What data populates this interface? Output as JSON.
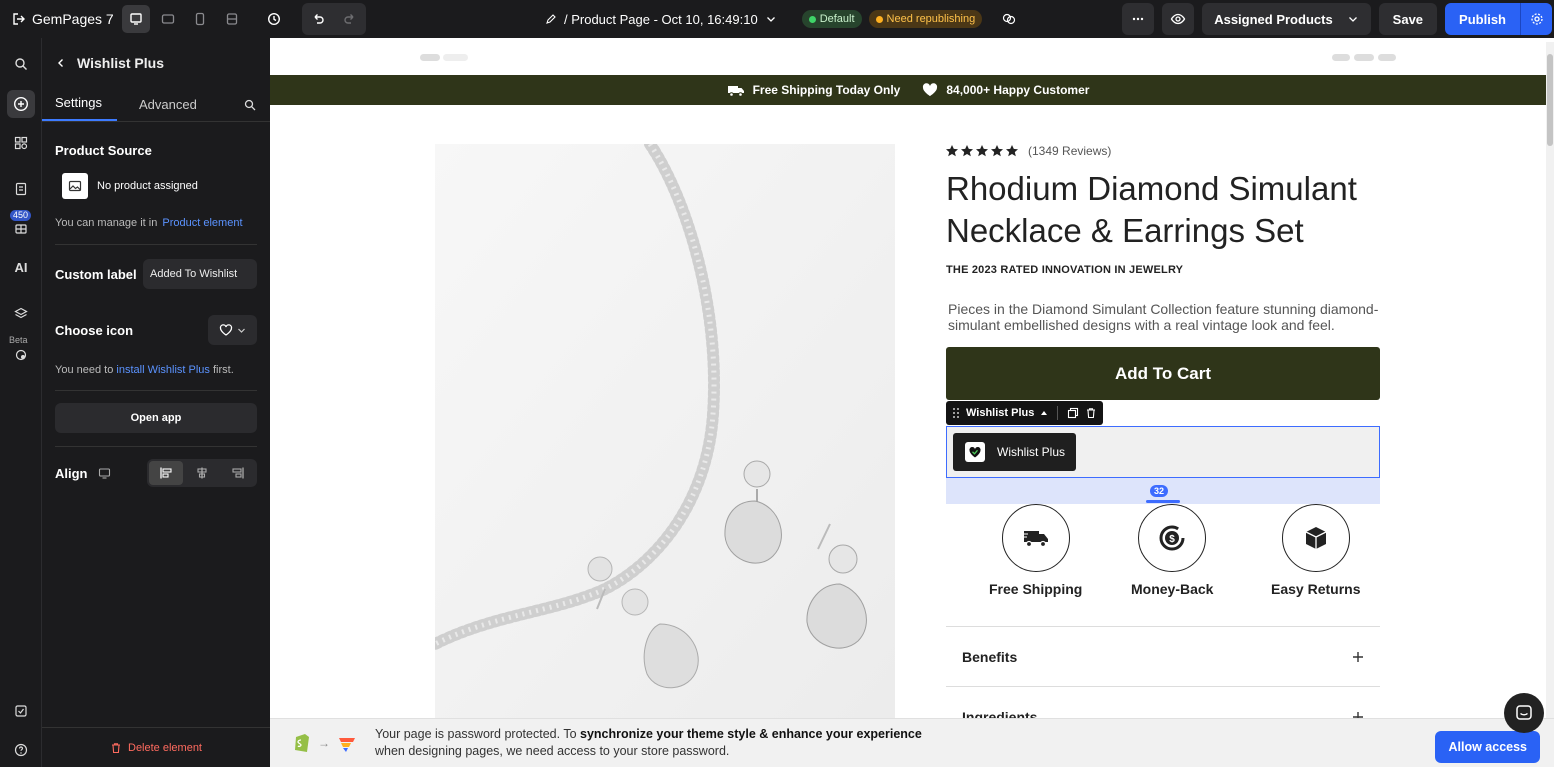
{
  "topbar": {
    "app_name": "GemPages 7",
    "page_title": "/ Product Page - Oct 10, 16:49:10",
    "status_default": "Default",
    "status_republish": "Need republishing",
    "assigned_label": "Assigned Products",
    "save_label": "Save",
    "publish_label": "Publish"
  },
  "rail": {
    "badge_count": "450",
    "beta_label": "Beta"
  },
  "panel": {
    "title": "Wishlist Plus",
    "tabs": [
      "Settings",
      "Advanced"
    ],
    "product_source_label": "Product Source",
    "no_product": "No product assigned",
    "manage_text": "You can manage it in",
    "manage_link": "Product element",
    "custom_label_label": "Custom label",
    "custom_label_value": "Added To Wishlist",
    "choose_icon_label": "Choose icon",
    "install_prefix": "You need to",
    "install_link": "install Wishlist Plus",
    "install_suffix": "first.",
    "open_app": "Open app",
    "align_label": "Align",
    "delete_label": "Delete element"
  },
  "banner": {
    "item1": "Free Shipping Today Only",
    "item2": "84,000+ Happy Customer"
  },
  "product": {
    "reviews": "(1349 Reviews)",
    "rating": 5,
    "title": "Rhodium Diamond Simulant Necklace & Earrings Set",
    "kicker": "THE 2023 RATED INNOVATION IN JEWELRY",
    "description": "Pieces in the Diamond Simulant Collection feature stunning diamond-simulant embellished designs with a real vintage look and feel.",
    "add_to_cart": "Add To Cart",
    "selected_tool_label": "Wishlist Plus",
    "wishlist_button": "Wishlist Plus",
    "spacing_value": "32",
    "features": [
      "Free Shipping",
      "Money-Back",
      "Easy Returns"
    ],
    "accordions": [
      "Benefits",
      "Ingredients"
    ]
  },
  "password_bar": {
    "line1_prefix": "Your page is password protected. To",
    "line1_bold": "synchronize your theme style & enhance your experience",
    "line2": "when designing pages, we need access to your store password.",
    "allow_button": "Allow access"
  },
  "colors": {
    "accent": "#2a62f5",
    "brand_dark_green": "#2f3519",
    "selection_blue": "#3d6cff"
  }
}
